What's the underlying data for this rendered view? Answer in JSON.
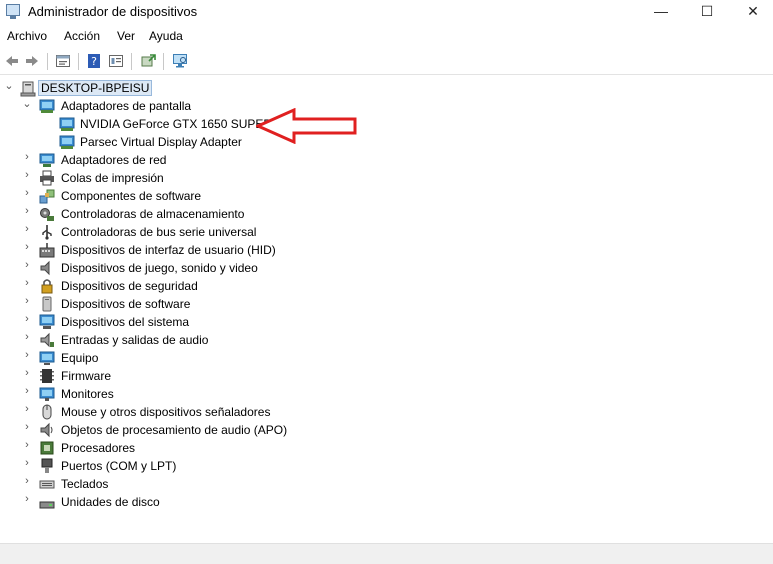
{
  "window": {
    "title": "Administrador de dispositivos",
    "controls": {
      "minimize": "—",
      "maximize": "☐",
      "close": "✕"
    }
  },
  "menu": [
    "Archivo",
    "Acción",
    "Ver",
    "Ayuda"
  ],
  "toolbar": [
    {
      "icon": "back-arrow-icon"
    },
    {
      "icon": "forward-arrow-icon"
    },
    {
      "icon": "properties-icon"
    },
    {
      "icon": "help-icon"
    },
    {
      "icon": "view-icon"
    },
    {
      "icon": "update-driver-icon"
    },
    {
      "icon": "scan-hardware-icon"
    }
  ],
  "tree": {
    "root": "DESKTOP-IBPEISU",
    "expanded_category": "Adaptadores de pantalla",
    "expanded_children": [
      "NVIDIA GeForce GTX 1650 SUPER",
      "Parsec Virtual Display Adapter"
    ],
    "categories": [
      {
        "label": "Adaptadores de red",
        "icon": "network-adapter-icon"
      },
      {
        "label": "Colas de impresión",
        "icon": "printer-icon"
      },
      {
        "label": "Componentes de software",
        "icon": "software-component-icon"
      },
      {
        "label": "Controladoras de almacenamiento",
        "icon": "storage-controller-icon"
      },
      {
        "label": "Controladoras de bus serie universal",
        "icon": "usb-icon"
      },
      {
        "label": "Dispositivos de interfaz de usuario (HID)",
        "icon": "hid-icon"
      },
      {
        "label": "Dispositivos de juego, sonido y video",
        "icon": "speaker-icon"
      },
      {
        "label": "Dispositivos de seguridad",
        "icon": "security-device-icon"
      },
      {
        "label": "Dispositivos de software",
        "icon": "software-device-icon"
      },
      {
        "label": "Dispositivos del sistema",
        "icon": "system-device-icon"
      },
      {
        "label": "Entradas y salidas de audio",
        "icon": "audio-io-icon"
      },
      {
        "label": "Equipo",
        "icon": "computer-icon"
      },
      {
        "label": "Firmware",
        "icon": "firmware-icon"
      },
      {
        "label": "Monitores",
        "icon": "monitor-icon"
      },
      {
        "label": "Mouse y otros dispositivos señaladores",
        "icon": "mouse-icon"
      },
      {
        "label": "Objetos de procesamiento de audio (APO)",
        "icon": "audio-apo-icon"
      },
      {
        "label": "Procesadores",
        "icon": "processor-icon"
      },
      {
        "label": "Puertos (COM y LPT)",
        "icon": "port-icon"
      },
      {
        "label": "Teclados",
        "icon": "keyboard-icon"
      },
      {
        "label": "Unidades de disco",
        "icon": "disk-drive-icon"
      }
    ]
  },
  "annotation": {
    "icon": "red-arrow-icon",
    "color": "#e02020"
  }
}
